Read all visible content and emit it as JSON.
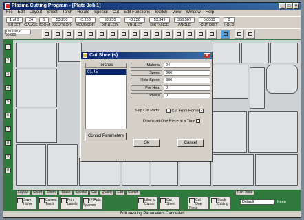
{
  "window": {
    "title": "Plasma Cutting Program - [Plate Job 1]"
  },
  "menu": [
    "File",
    "Edit",
    "Layout",
    "Sheet",
    "Torch",
    "Rotate",
    "Special",
    "Cut",
    "Edit Functions",
    "Sketch",
    "View",
    "Window",
    "Help"
  ],
  "status_fields": [
    {
      "value": "1 of 3",
      "label": "SHEET"
    },
    {
      "value": "24",
      "label": "GAUGE"
    },
    {
      "value": "1",
      "label": "ZOOM"
    },
    {
      "value": "53.250",
      "label": "XCURSOR"
    },
    {
      "value": "-3.250",
      "label": "YCURSOR"
    },
    {
      "value": "53.250",
      "label": "XRULER"
    },
    {
      "value": "-3.250",
      "label": "YRULER"
    },
    {
      "value": "53.349",
      "label": "DISTANCE"
    },
    {
      "value": "356.507",
      "label": "ANGLE"
    },
    {
      "value": "0.0000",
      "label": "CUT DIST"
    },
    {
      "value": "0",
      "label": "HOLD"
    }
  ],
  "sheet_size": "120.000 x 60.000",
  "left_buttons": [
    "1",
    "2",
    "3",
    "4",
    "5",
    "6",
    "7",
    "8",
    "9",
    "0"
  ],
  "dialog": {
    "title": "Cut Sheet(s)",
    "torches_header": "Torches",
    "torch_items": [
      "01.45"
    ],
    "control_params_button": "Control Parameters",
    "fields": [
      {
        "label": "Material",
        "value": "24"
      },
      {
        "label": "Speed",
        "value": "306"
      },
      {
        "label": "Hole Speed",
        "value": "306"
      },
      {
        "label": "Pre Heat",
        "value": "0"
      },
      {
        "label": "Pierce",
        "value": "0"
      }
    ],
    "skip_cut_parts": "Skip Cut Parts",
    "cut_from_home": "Cut From Home",
    "cut_from_home_checked": true,
    "download_one": "Download One Piece at a Time",
    "ok": "Ok",
    "cancel": "Cancel"
  },
  "bottom_tabs": [
    "Layout",
    "Sheet",
    "Zoom",
    "Rotate",
    "Special",
    "Cut",
    "Quality",
    "Edit",
    "Sketch"
  ],
  "bottom_buttons": [
    "Save Home",
    "Current Torch",
    "Print Labels",
    "(F)Auto Spacers",
    "Lilog to Cursor",
    "Cut Sheet",
    "Cut One Piece",
    "Stock Cutting"
  ],
  "part_tools_label": "Part Tools",
  "select_value": "Default",
  "keep_label": "Keep",
  "status_message": "Edit Nesting Parameters Cancelled"
}
